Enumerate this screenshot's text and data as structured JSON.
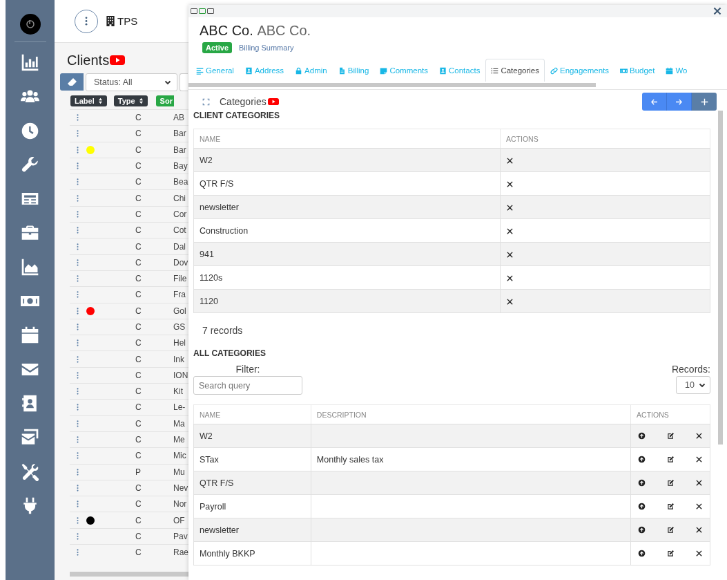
{
  "header": {
    "title": "TPS"
  },
  "clients": {
    "title": "Clients",
    "status_filter": "Status: All",
    "columns": [
      "Label",
      "Type",
      "Sor"
    ],
    "rows": [
      {
        "type": "C",
        "name": "AB"
      },
      {
        "type": "C",
        "name": "Bar"
      },
      {
        "type": "C",
        "name": "Bar",
        "color": "#ffff00"
      },
      {
        "type": "C",
        "name": "Bay"
      },
      {
        "type": "C",
        "name": "Bea"
      },
      {
        "type": "C",
        "name": "Chi"
      },
      {
        "type": "C",
        "name": "Cor"
      },
      {
        "type": "C",
        "name": "Cot"
      },
      {
        "type": "C",
        "name": "Dal"
      },
      {
        "type": "C",
        "name": "Dov"
      },
      {
        "type": "C",
        "name": "File"
      },
      {
        "type": "C",
        "name": "Fra"
      },
      {
        "type": "C",
        "name": "Gol",
        "color": "#ff0000"
      },
      {
        "type": "C",
        "name": "GS"
      },
      {
        "type": "C",
        "name": "Hel"
      },
      {
        "type": "C",
        "name": "Ink"
      },
      {
        "type": "C",
        "name": "ION"
      },
      {
        "type": "C",
        "name": "Kit"
      },
      {
        "type": "C",
        "name": "Le-"
      },
      {
        "type": "C",
        "name": "Ma"
      },
      {
        "type": "C",
        "name": "Me"
      },
      {
        "type": "C",
        "name": "Mic"
      },
      {
        "type": "P",
        "name": "Mu"
      },
      {
        "type": "C",
        "name": "Nev"
      },
      {
        "type": "C",
        "name": "Nor"
      },
      {
        "type": "C",
        "name": "OF",
        "color": "#000000"
      },
      {
        "type": "C",
        "name": "Pav"
      },
      {
        "type": "C",
        "name": "Rae"
      }
    ]
  },
  "dialog": {
    "title": "ABC Co.",
    "subtitle": "ABC Co.",
    "status": "Active",
    "link": "Billing Summary",
    "tabs": [
      {
        "label": "General",
        "selected": false
      },
      {
        "label": "Address",
        "selected": false
      },
      {
        "label": "Admin",
        "selected": false
      },
      {
        "label": "Billing",
        "selected": false
      },
      {
        "label": "Comments",
        "selected": false
      },
      {
        "label": "Contacts",
        "selected": false
      },
      {
        "label": "Categories",
        "selected": true
      },
      {
        "label": "Engagements",
        "selected": false
      },
      {
        "label": "Budget",
        "selected": false
      },
      {
        "label": "Wo",
        "selected": false
      }
    ],
    "panel_title": "Categories",
    "client_categories": {
      "heading": "CLIENT CATEGORIES",
      "columns": [
        "NAME",
        "ACTIONS"
      ],
      "rows": [
        {
          "name": "W2"
        },
        {
          "name": "QTR F/S"
        },
        {
          "name": "newsletter"
        },
        {
          "name": "Construction"
        },
        {
          "name": "941"
        },
        {
          "name": "1120s"
        },
        {
          "name": "1120"
        }
      ],
      "count": "7 records"
    },
    "all_categories": {
      "heading": "ALL CATEGORIES",
      "filter_label": "Filter:",
      "search": {
        "placeholder": "Search query"
      },
      "records_label": "Records:",
      "page_size": "10",
      "columns": [
        "NAME",
        "DESCRIPTION",
        "ACTIONS"
      ],
      "rows": [
        {
          "name": "W2"
        },
        {
          "name": "STax",
          "description": "Monthly sales tax"
        },
        {
          "name": "QTR F/S"
        },
        {
          "name": "Payroll"
        },
        {
          "name": "newsletter"
        },
        {
          "name": "Monthly BKKP"
        }
      ]
    }
  }
}
